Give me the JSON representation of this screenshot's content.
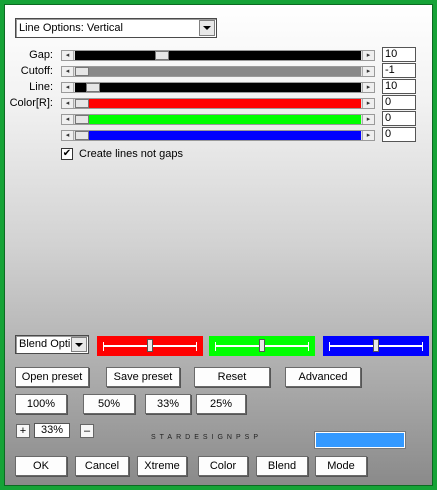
{
  "mode_dropdown": {
    "value": "Line Options: Vertical"
  },
  "params": [
    {
      "label": "Gap:",
      "value": "10",
      "track_color": "#000000",
      "level": 0.295
    },
    {
      "label": "Cutoff:",
      "value": "-1",
      "track_color": "#888888",
      "level": 0.0
    },
    {
      "label": "Line:",
      "value": "10",
      "track_color": "#000000",
      "level": 0.04
    },
    {
      "label": "Color[R]:",
      "value": "0",
      "track_color": "#ff0000",
      "level": 0.0
    },
    {
      "label": "",
      "value": "0",
      "track_color": "#00ff00",
      "level": 0.0
    },
    {
      "label": "",
      "value": "0",
      "track_color": "#0000ff",
      "level": 0.0
    }
  ],
  "create_lines": {
    "label": "Create lines not gaps",
    "checked": true
  },
  "blend": {
    "select_value": "Blend Options",
    "rgb": [
      {
        "color": "#ff0000",
        "level": 0.5
      },
      {
        "color": "#00ff00",
        "level": 0.5
      },
      {
        "color": "#0000ff",
        "level": 0.5
      }
    ]
  },
  "preset_buttons": [
    "Open preset",
    "Save preset",
    "Reset",
    "Advanced"
  ],
  "zoom_buttons": [
    "100%",
    "50%",
    "33%",
    "25%"
  ],
  "zoom": {
    "plus": "+",
    "value": "33%",
    "minus": "–"
  },
  "brand_text": "STARDESIGNPSP",
  "preview_color": "#3399ff",
  "bottom_buttons": [
    "OK",
    "Cancel",
    "Xtreme",
    "Color",
    "Blend",
    "Mode"
  ]
}
